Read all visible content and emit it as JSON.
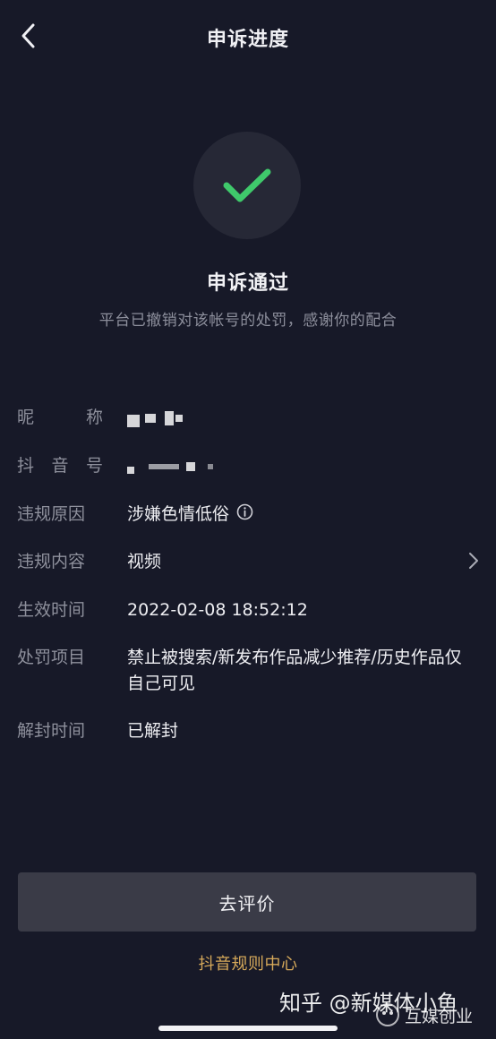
{
  "header": {
    "title": "申诉进度",
    "back_icon": "chevron-left-icon"
  },
  "status": {
    "icon": "check-icon",
    "accent_color": "#3fc96b",
    "title": "申诉通过",
    "description": "平台已撤销对该帐号的处罚，感谢你的配合"
  },
  "details": {
    "nickname": {
      "label": "昵称",
      "value_obscured": true
    },
    "douyin_id": {
      "label": "抖音号",
      "value_obscured": true
    },
    "violation_reason": {
      "label": "违规原因",
      "value": "涉嫌色情低俗",
      "icon": "info-circle-icon"
    },
    "violation_content": {
      "label": "违规内容",
      "value": "视频",
      "icon": "chevron-right-icon"
    },
    "effective_time": {
      "label": "生效时间",
      "value": "2022-02-08 18:52:12"
    },
    "penalty_items": {
      "label": "处罚项目",
      "value": "禁止被搜索/新发布作品减少推荐/历史作品仅自己可见"
    },
    "unban_time": {
      "label": "解封时间",
      "value": "已解封"
    }
  },
  "actions": {
    "rate_button_label": "去评价",
    "rules_link_label": "抖音规则中心",
    "link_color": "#d6a95a"
  },
  "watermark": {
    "text": "知乎 @新媒体小鱼",
    "logo_text": "互媒创业"
  }
}
